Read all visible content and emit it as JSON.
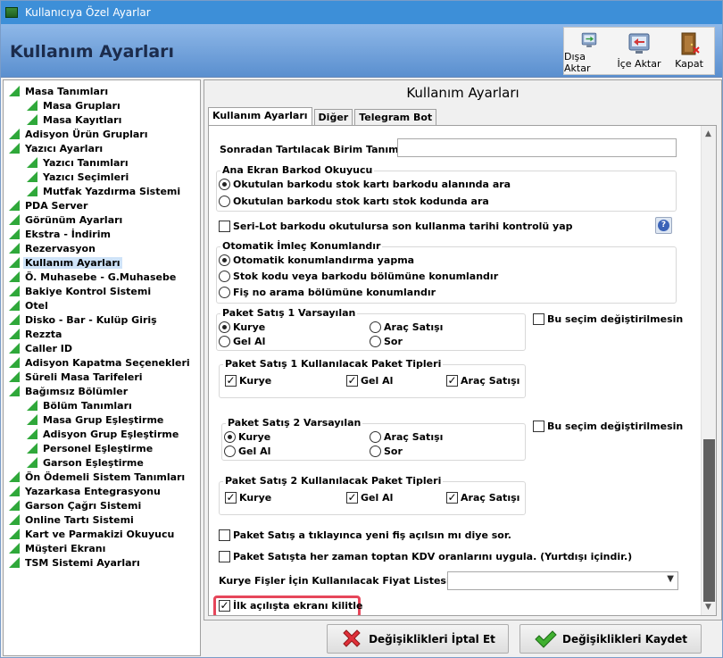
{
  "window": {
    "title": "Kullanıcıya Özel Ayarlar"
  },
  "header": {
    "title": "Kullanım Ayarları"
  },
  "toolbar": {
    "export_label": "Dışa Aktar",
    "import_label": "İçe Aktar",
    "close_label": "Kapat"
  },
  "sidebar": {
    "items": [
      {
        "label": "Masa Tanımları",
        "level": 0
      },
      {
        "label": "Masa Grupları",
        "level": 1
      },
      {
        "label": "Masa Kayıtları",
        "level": 1
      },
      {
        "label": "Adisyon Ürün Grupları",
        "level": 0
      },
      {
        "label": "Yazıcı Ayarları",
        "level": 0
      },
      {
        "label": "Yazıcı Tanımları",
        "level": 1
      },
      {
        "label": "Yazıcı Seçimleri",
        "level": 1
      },
      {
        "label": "Mutfak Yazdırma Sistemi",
        "level": 1
      },
      {
        "label": "PDA Server",
        "level": 0
      },
      {
        "label": "Görünüm Ayarları",
        "level": 0
      },
      {
        "label": "Ekstra - İndirim",
        "level": 0
      },
      {
        "label": "Rezervasyon",
        "level": 0
      },
      {
        "label": "Kullanım Ayarları",
        "level": 0,
        "selected": true
      },
      {
        "label": "Ö. Muhasebe - G.Muhasebe",
        "level": 0
      },
      {
        "label": "Bakiye Kontrol Sistemi",
        "level": 0
      },
      {
        "label": "Otel",
        "level": 0
      },
      {
        "label": "Disko - Bar - Kulüp Giriş",
        "level": 0
      },
      {
        "label": "Rezzta",
        "level": 0
      },
      {
        "label": "Caller ID",
        "level": 0
      },
      {
        "label": "Adisyon Kapatma Seçenekleri",
        "level": 0
      },
      {
        "label": "Süreli Masa Tarifeleri",
        "level": 0
      },
      {
        "label": "Bağımsız Bölümler",
        "level": 0
      },
      {
        "label": "Bölüm Tanımları",
        "level": 1
      },
      {
        "label": "Masa Grup Eşleştirme",
        "level": 1
      },
      {
        "label": "Adisyon Grup Eşleştirme",
        "level": 1
      },
      {
        "label": "Personel Eşleştirme",
        "level": 1
      },
      {
        "label": "Garson Eşleştirme",
        "level": 1
      },
      {
        "label": "Ön Ödemeli Sistem Tanımları",
        "level": 0
      },
      {
        "label": "Yazarkasa Entegrasyonu",
        "level": 0
      },
      {
        "label": "Garson Çağrı Sistemi",
        "level": 0
      },
      {
        "label": "Online Tartı Sistemi",
        "level": 0
      },
      {
        "label": "Kart ve Parmakizi Okuyucu",
        "level": 0
      },
      {
        "label": "Müşteri Ekranı",
        "level": 0
      },
      {
        "label": "TSM Sistemi Ayarları",
        "level": 0
      }
    ]
  },
  "content": {
    "title": "Kullanım Ayarları",
    "tabs": [
      {
        "label": "Kullanım Ayarları",
        "active": true
      },
      {
        "label": "Diğer",
        "active": false
      },
      {
        "label": "Telegram Bot",
        "active": false
      }
    ],
    "weighed_unit_label": "Sonradan Tartılacak Birim Tanımı",
    "weighed_unit_value": "",
    "barcode_group": {
      "title": "Ana Ekran Barkod Okuyucu",
      "options": [
        "Okutulan barkodu stok kartı barkodu alanında ara",
        "Okutulan barkodu stok kartı stok kodunda ara"
      ],
      "selected": 0
    },
    "serial_lot_check": {
      "label": "Seri-Lot barkodu okutulursa son kullanma tarihi kontrolü yap",
      "checked": false
    },
    "help_icon": "question-icon",
    "cursor_group": {
      "title": "Otomatik İmleç Konumlandır",
      "options": [
        "Otomatik konumlandırma yapma",
        "Stok kodu veya barkodu bölümüne konumlandır",
        "Fiş no arama bölümüne konumlandır"
      ],
      "selected": 0
    },
    "pkg1_default": {
      "title": "Paket Satış 1 Varsayılan",
      "options": [
        "Kurye",
        "Araç Satışı",
        "Gel Al",
        "Sor"
      ],
      "selected": 0
    },
    "pkg1_lock": {
      "label": "Bu seçim değiştirilmesin",
      "checked": false
    },
    "pkg1_types": {
      "title": "Paket Satış 1 Kullanılacak Paket Tipleri",
      "options": [
        {
          "label": "Kurye",
          "checked": true
        },
        {
          "label": "Gel Al",
          "checked": true
        },
        {
          "label": "Araç Satışı",
          "checked": true
        }
      ]
    },
    "pkg2_default": {
      "title": "Paket Satış 2 Varsayılan",
      "options": [
        "Kurye",
        "Araç Satışı",
        "Gel Al",
        "Sor"
      ],
      "selected": 0
    },
    "pkg2_lock": {
      "label": "Bu seçim değiştirilmesin",
      "checked": false
    },
    "pkg2_types": {
      "title": "Paket Satış 2 Kullanılacak Paket Tipleri",
      "options": [
        {
          "label": "Kurye",
          "checked": true
        },
        {
          "label": "Gel Al",
          "checked": true
        },
        {
          "label": "Araç Satışı",
          "checked": true
        }
      ]
    },
    "pkg_click_check": {
      "label": "Paket Satış a tıklayınca yeni fiş açılsın mı diye sor.",
      "checked": false
    },
    "wholesale_kdv_check": {
      "label": "Paket Satışta her zaman toptan KDV oranlarını uygula. (Yurtdışı içindir.)",
      "checked": false
    },
    "courier_price_label": "Kurye Fişler İçin Kullanılacak Fiyat Listesi",
    "courier_price_value": "",
    "lock_screen_check": {
      "label": "İlk açılışta ekranı kilitle",
      "checked": true
    }
  },
  "footer": {
    "cancel_label": "Değişiklikleri İptal Et",
    "save_label": "Değişiklikleri Kaydet"
  },
  "colors": {
    "header_bg": "#5a8fcf",
    "titlebar": "#3d8fd8",
    "highlight": "#e6465a",
    "tree_leaf": "#2fa83a",
    "selected_bg": "#cfe3f8"
  }
}
